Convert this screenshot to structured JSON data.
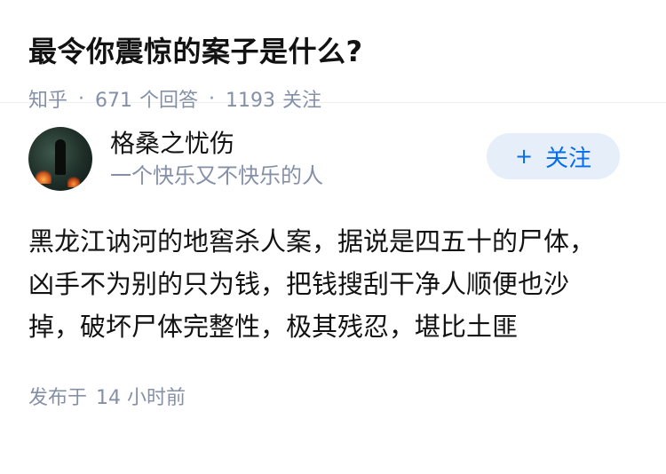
{
  "question": {
    "title": "最令你震惊的案子是什么?",
    "source": "知乎",
    "separator": "·",
    "answer_count": "671",
    "answer_label": "个回答",
    "follower_count": "1193",
    "follower_label": "关注"
  },
  "answer": {
    "author_name": "格桑之忧伤",
    "author_bio": "一个快乐又不快乐的人",
    "follow_plus": "+",
    "follow_label": "关注",
    "content": "黑龙江讷河的地窖杀人案，据说是四五十的尸体，凶手不为别的只为钱，把钱搜刮干净人顺便也沙掉，破坏尸体完整性，极其残忍，堪比土匪",
    "published_label": "发布于",
    "published_time": "14 小时前"
  }
}
